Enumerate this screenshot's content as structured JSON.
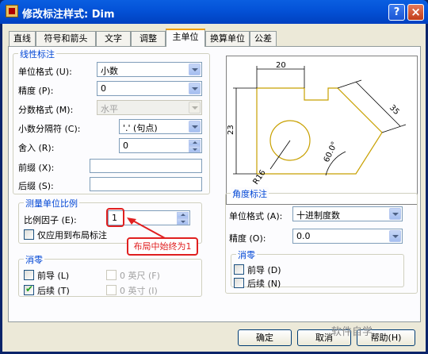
{
  "window": {
    "title": "修改标注样式: Dim",
    "help": "?",
    "close": "×"
  },
  "tabs": [
    {
      "label": "直线"
    },
    {
      "label": "符号和箭头"
    },
    {
      "label": "文字"
    },
    {
      "label": "调整"
    },
    {
      "label": "主单位",
      "active": true
    },
    {
      "label": "换算单位"
    },
    {
      "label": "公差"
    }
  ],
  "linear": {
    "title": "线性标注",
    "unit_format": {
      "label": "单位格式 (U):",
      "value": "小数"
    },
    "precision": {
      "label": "精度 (P):",
      "value": "0"
    },
    "fraction_format": {
      "label": "分数格式 (M):",
      "value": "水平"
    },
    "decimal_separator": {
      "label": "小数分隔符 (C):",
      "value": "'.' (句点)"
    },
    "round_off": {
      "label": "舍入 (R):",
      "value": "0"
    },
    "prefix": {
      "label": "前缀 (X):",
      "value": ""
    },
    "suffix": {
      "label": "后缀 (S):",
      "value": ""
    }
  },
  "measurement_scale": {
    "title": "测量单位比例",
    "scale_factor": {
      "label": "比例因子 (E):",
      "value": "1"
    },
    "layout_only": {
      "label": "仅应用到布局标注",
      "checked": false
    }
  },
  "linear_zero": {
    "title": "消零",
    "leading": {
      "label": "前导 (L)",
      "checked": false
    },
    "trailing": {
      "label": "后续 (T)",
      "checked": true
    },
    "feet": {
      "label": "0 英尺 (F)",
      "checked": false
    },
    "inches": {
      "label": "0 英寸 (I)",
      "checked": false
    }
  },
  "angular": {
    "title": "角度标注",
    "unit_format": {
      "label": "单位格式 (A):",
      "value": "十进制度数"
    },
    "precision": {
      "label": "精度 (O):",
      "value": "0.0"
    },
    "zero_title": "消零",
    "leading": {
      "label": "前导 (D)",
      "checked": false
    },
    "trailing": {
      "label": "后续 (N)",
      "checked": false
    }
  },
  "preview": {
    "dims": {
      "top": "20",
      "left": "23",
      "right": "35",
      "angle": "60.0°",
      "radius": "R16"
    },
    "colors": {
      "geometry": "#c8a000",
      "dimension": "#000000",
      "background": "#ffffff"
    }
  },
  "annotation": {
    "text": "布局中始终为1",
    "color": "#e02020"
  },
  "buttons": {
    "ok": "确定",
    "cancel": "取消",
    "help": "帮助(H)"
  },
  "watermark": "软件自学"
}
